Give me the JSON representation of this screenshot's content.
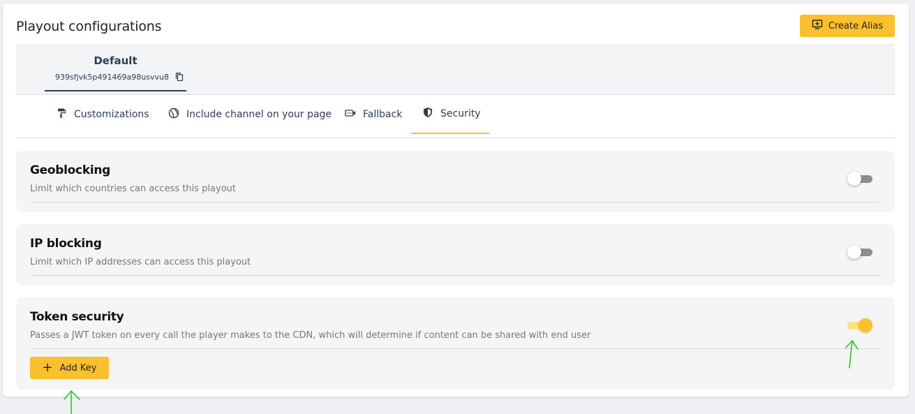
{
  "header": {
    "title": "Playout configurations",
    "create_alias_label": "Create Alias",
    "create_alias_icon": "add-screen-icon"
  },
  "alias": {
    "name": "Default",
    "id": "939sfjvk5p491469a98usvvu8",
    "copy_icon": "copy-icon"
  },
  "tabs": [
    {
      "label": "Customizations",
      "icon": "paint-roller-icon"
    },
    {
      "label": "Include channel on your page",
      "icon": "globe-icon"
    },
    {
      "label": "Fallback",
      "icon": "video-icon"
    },
    {
      "label": "Security",
      "icon": "shield-icon",
      "active": true
    }
  ],
  "sections": {
    "geoblocking": {
      "title": "Geoblocking",
      "description": "Limit which countries can access this playout",
      "enabled": false
    },
    "ip_blocking": {
      "title": "IP blocking",
      "description": "Limit which IP addresses can access this playout",
      "enabled": false
    },
    "token_security": {
      "title": "Token security",
      "description": "Passes a JWT token on every call the player makes to the CDN, which will determine if content can be shared with end user",
      "enabled": true,
      "add_key_label": "Add Key"
    }
  },
  "colors": {
    "accent": "#fbc02d",
    "primary_text": "#2f3e55",
    "annotation": "#22cc22"
  }
}
